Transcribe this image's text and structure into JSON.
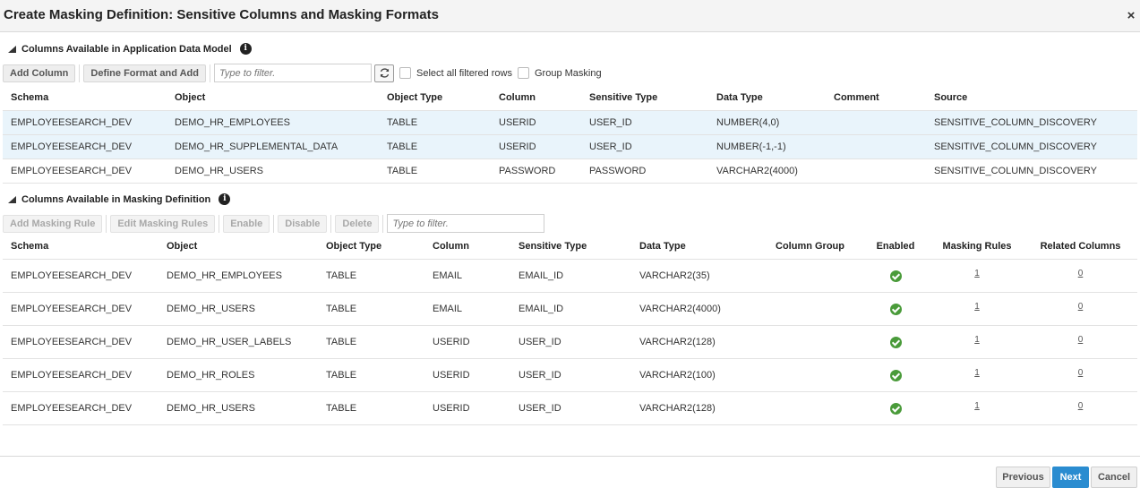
{
  "dialog": {
    "title": "Create Masking Definition: Sensitive Columns and Masking Formats",
    "close_symbol": "×"
  },
  "section1": {
    "title": "Columns Available in Application Data Model",
    "info_symbol": "i",
    "toolbar": {
      "add_column": "Add Column",
      "define_format": "Define Format and Add",
      "filter_placeholder": "Type to filter.",
      "select_all_label": "Select all filtered rows",
      "group_masking_label": "Group Masking"
    },
    "columns": [
      "Schema",
      "Object",
      "Object Type",
      "Column",
      "Sensitive Type",
      "Data Type",
      "Comment",
      "Source"
    ],
    "rows": [
      {
        "schema": "EMPLOYEESEARCH_DEV",
        "object": "DEMO_HR_EMPLOYEES",
        "object_type": "TABLE",
        "column": "USERID",
        "sensitive_type": "USER_ID",
        "data_type": "NUMBER(4,0)",
        "comment": "",
        "source": "SENSITIVE_COLUMN_DISCOVERY",
        "selected": true
      },
      {
        "schema": "EMPLOYEESEARCH_DEV",
        "object": "DEMO_HR_SUPPLEMENTAL_DATA",
        "object_type": "TABLE",
        "column": "USERID",
        "sensitive_type": "USER_ID",
        "data_type": "NUMBER(-1,-1)",
        "comment": "",
        "source": "SENSITIVE_COLUMN_DISCOVERY",
        "selected": true
      },
      {
        "schema": "EMPLOYEESEARCH_DEV",
        "object": "DEMO_HR_USERS",
        "object_type": "TABLE",
        "column": "PASSWORD",
        "sensitive_type": "PASSWORD",
        "data_type": "VARCHAR2(4000)",
        "comment": "",
        "source": "SENSITIVE_COLUMN_DISCOVERY",
        "selected": false
      }
    ]
  },
  "section2": {
    "title": "Columns Available in Masking Definition",
    "info_symbol": "i",
    "toolbar": {
      "add_rule": "Add Masking Rule",
      "edit_rules": "Edit Masking Rules",
      "enable": "Enable",
      "disable": "Disable",
      "delete": "Delete",
      "filter_placeholder": "Type to filter."
    },
    "columns": [
      "Schema",
      "Object",
      "Object Type",
      "Column",
      "Sensitive Type",
      "Data Type",
      "Column Group",
      "Enabled",
      "Masking Rules",
      "Related Columns"
    ],
    "rows": [
      {
        "schema": "EMPLOYEESEARCH_DEV",
        "object": "DEMO_HR_EMPLOYEES",
        "object_type": "TABLE",
        "column": "EMAIL",
        "sensitive_type": "EMAIL_ID",
        "data_type": "VARCHAR2(35)",
        "column_group": "",
        "enabled": true,
        "masking_rules": "1",
        "related_columns": "0"
      },
      {
        "schema": "EMPLOYEESEARCH_DEV",
        "object": "DEMO_HR_USERS",
        "object_type": "TABLE",
        "column": "EMAIL",
        "sensitive_type": "EMAIL_ID",
        "data_type": "VARCHAR2(4000)",
        "column_group": "",
        "enabled": true,
        "masking_rules": "1",
        "related_columns": "0"
      },
      {
        "schema": "EMPLOYEESEARCH_DEV",
        "object": "DEMO_HR_USER_LABELS",
        "object_type": "TABLE",
        "column": "USERID",
        "sensitive_type": "USER_ID",
        "data_type": "VARCHAR2(128)",
        "column_group": "",
        "enabled": true,
        "masking_rules": "1",
        "related_columns": "0"
      },
      {
        "schema": "EMPLOYEESEARCH_DEV",
        "object": "DEMO_HR_ROLES",
        "object_type": "TABLE",
        "column": "USERID",
        "sensitive_type": "USER_ID",
        "data_type": "VARCHAR2(100)",
        "column_group": "",
        "enabled": true,
        "masking_rules": "1",
        "related_columns": "0"
      },
      {
        "schema": "EMPLOYEESEARCH_DEV",
        "object": "DEMO_HR_USERS",
        "object_type": "TABLE",
        "column": "USERID",
        "sensitive_type": "USER_ID",
        "data_type": "VARCHAR2(128)",
        "column_group": "",
        "enabled": true,
        "masking_rules": "1",
        "related_columns": "0"
      }
    ]
  },
  "footer": {
    "previous": "Previous",
    "next": "Next",
    "cancel": "Cancel"
  },
  "colors": {
    "primary_button": "#2a8cd0",
    "selected_row": "#e9f4fb",
    "enabled_check": "#4a9b3a"
  },
  "icons": {
    "refresh": "refresh-icon",
    "enabled": "check-circle-icon",
    "info": "info-icon",
    "collapse": "collapse-triangle-icon",
    "close": "close-icon"
  }
}
